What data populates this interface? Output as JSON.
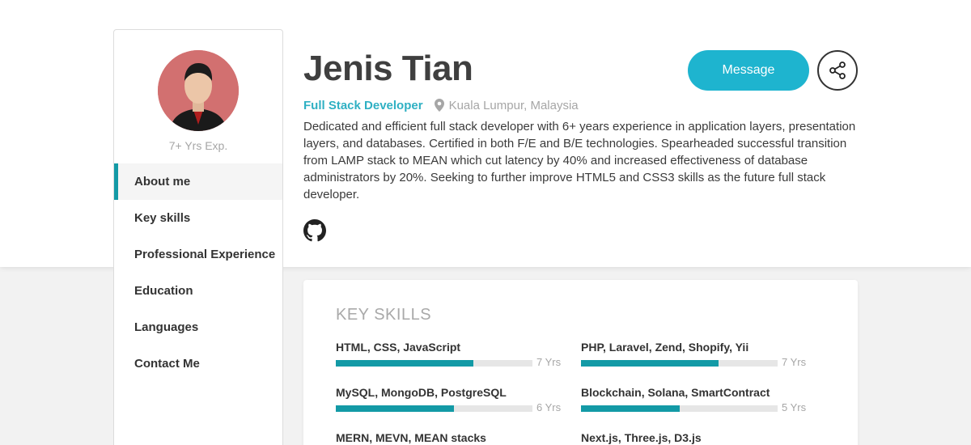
{
  "profile": {
    "name": "Jenis Tian",
    "role": "Full Stack Developer",
    "location": "Kuala Lumpur, Malaysia",
    "experience": "7+ Yrs Exp.",
    "bio": "Dedicated and efficient full stack developer with 6+ years experience in application layers, presentation layers, and databases. Certified in both F/E and B/E technologies. Spearheaded successful transition from LAMP stack to MEAN which cut latency by 40% and increased effectiveness of database administrators by 20%. Seeking to further improve HTML5 and CSS3 skills as the future full stack developer."
  },
  "actions": {
    "message_label": "Message",
    "share_icon": "share-icon",
    "github_icon": "github-icon"
  },
  "nav": {
    "items": [
      {
        "label": "About me",
        "active": true
      },
      {
        "label": "Key skills",
        "active": false
      },
      {
        "label": "Professional Experience",
        "active": false
      },
      {
        "label": "Education",
        "active": false
      },
      {
        "label": "Languages",
        "active": false
      },
      {
        "label": "Contact Me",
        "active": false
      }
    ]
  },
  "skills": {
    "heading": "KEY SKILLS",
    "items": [
      {
        "name": "HTML, CSS, JavaScript",
        "years": "7 Yrs",
        "level": 0.7
      },
      {
        "name": "PHP, Laravel, Zend, Shopify, Yii",
        "years": "7 Yrs",
        "level": 0.7
      },
      {
        "name": "MySQL, MongoDB, PostgreSQL",
        "years": "6 Yrs",
        "level": 0.6
      },
      {
        "name": "Blockchain, Solana, SmartContract",
        "years": "5 Yrs",
        "level": 0.5
      },
      {
        "name": "MERN, MEVN, MEAN stacks",
        "years": "",
        "level": 0
      },
      {
        "name": "Next.js, Three.js, D3.js",
        "years": "",
        "level": 0
      }
    ]
  },
  "colors": {
    "accent": "#139aa6",
    "button": "#1eb4cf",
    "role_text": "#2fb0c3",
    "muted": "#a6a6a6"
  }
}
